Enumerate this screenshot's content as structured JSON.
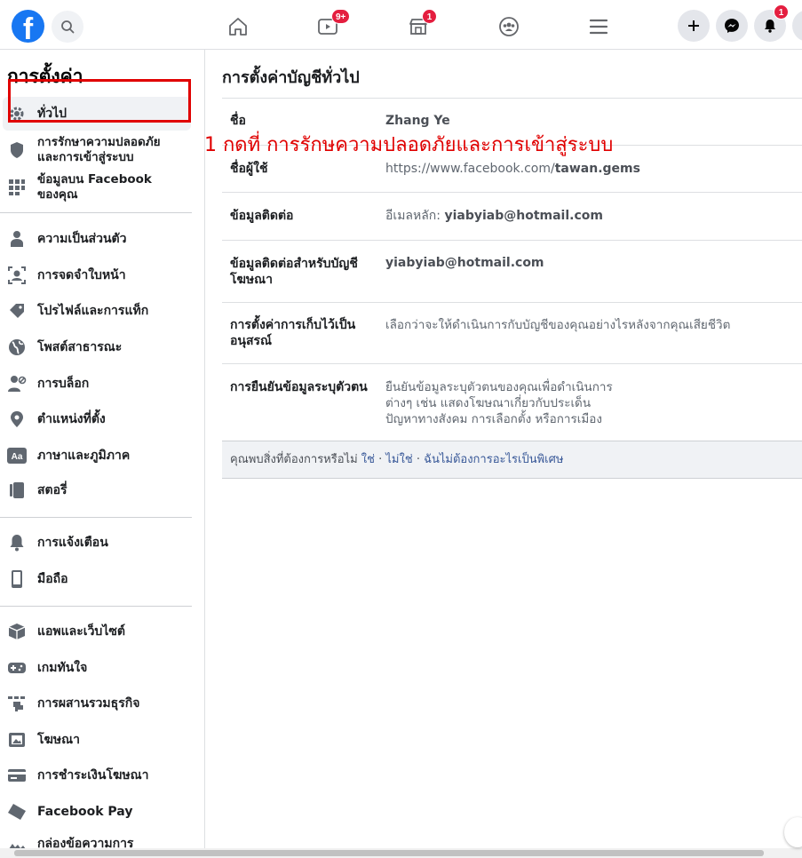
{
  "brand": {
    "logo_letter": "f",
    "color": "#1877f2"
  },
  "topbar": {
    "video_badge": "9+",
    "marketplace_badge": "1",
    "notifications_badge": "1"
  },
  "sidebar": {
    "title": "การตั้งค่า",
    "items": [
      {
        "label": "ทั่วไป",
        "icon": "gear-icon"
      },
      {
        "label": "การรักษาความปลอดภัยและการเข้าสู่ระบบ",
        "icon": "shield-icon"
      },
      {
        "label": "ข้อมูลบน Facebook ของคุณ",
        "icon": "grid-icon"
      },
      {
        "label": "ความเป็นส่วนตัว",
        "icon": "lock-person-icon"
      },
      {
        "label": "การจดจำใบหน้า",
        "icon": "face-icon"
      },
      {
        "label": "โปรไฟล์และการแท็ก",
        "icon": "tag-icon"
      },
      {
        "label": "โพสต์สาธารณะ",
        "icon": "globe-icon"
      },
      {
        "label": "การบล็อก",
        "icon": "block-user-icon"
      },
      {
        "label": "ตำแหน่งที่ตั้ง",
        "icon": "location-pin-icon"
      },
      {
        "label": "ภาษาและภูมิภาค",
        "icon": "language-icon"
      },
      {
        "label": "สตอรี่",
        "icon": "story-icon"
      },
      {
        "label": "การแจ้งเตือน",
        "icon": "bell-icon"
      },
      {
        "label": "มือถือ",
        "icon": "mobile-icon"
      },
      {
        "label": "แอพและเว็บไซต์",
        "icon": "cube-icon"
      },
      {
        "label": "เกมทันใจ",
        "icon": "gamepad-icon"
      },
      {
        "label": "การผสานรวมธุรกิจ",
        "icon": "puzzle-icon"
      },
      {
        "label": "โฆษณา",
        "icon": "ad-icon"
      },
      {
        "label": "การชำระเงินโฆษณา",
        "icon": "credit-card-icon"
      },
      {
        "label": "Facebook Pay",
        "icon": "pay-icon"
      },
      {
        "label": "กล่องข้อความการ",
        "icon": "inbox-icon"
      }
    ]
  },
  "annotation": "1 กดที่ การรักษความปลอดภัยและการเข้าสู่ระบบ",
  "main": {
    "title": "การตั้งค่าบัญชีทั่วไป",
    "rows": [
      {
        "label": "ชื่อ",
        "value": "Zhang Ye"
      },
      {
        "label": "ชื่อผู้ใช้",
        "value_prefix": "https://www.facebook.com/",
        "value_bold": "tawan.gems"
      },
      {
        "label": "ข้อมูลติดต่อ",
        "value_prefix": "อีเมลหลัก: ",
        "value_bold": "yiabyiab@hotmail.com"
      },
      {
        "label": "ข้อมูลติดต่อสำหรับบัญชีโฆษณา",
        "value_bold": "yiabyiab@hotmail.com"
      },
      {
        "label": "การตั้งค่าการเก็บไว้เป็นอนุสรณ์",
        "value": "เลือกว่าจะให้ดำเนินการกับบัญชีของคุณอย่างไรหลังจากคุณเสียชีวิต"
      },
      {
        "label": "การยืนยันข้อมูลระบุตัวตน",
        "value_lines": [
          "ยืนยันข้อมูลระบุตัวตนของคุณเพื่อดำเนินการ",
          "ต่างๆ เช่น แสดงโฆษณาเกี่ยวกับประเด็น",
          "ปัญหาทางสังคม การเลือกตั้ง หรือการเมือง"
        ]
      }
    ],
    "feedback": {
      "question": "คุณพบสิ่งที่ต้องการหรือไม่",
      "yes": "ใช่",
      "no": "ไม่ใช่",
      "nothing": "ฉันไม่ต้องการอะไรเป็นพิเศษ",
      "separator": "·"
    }
  }
}
